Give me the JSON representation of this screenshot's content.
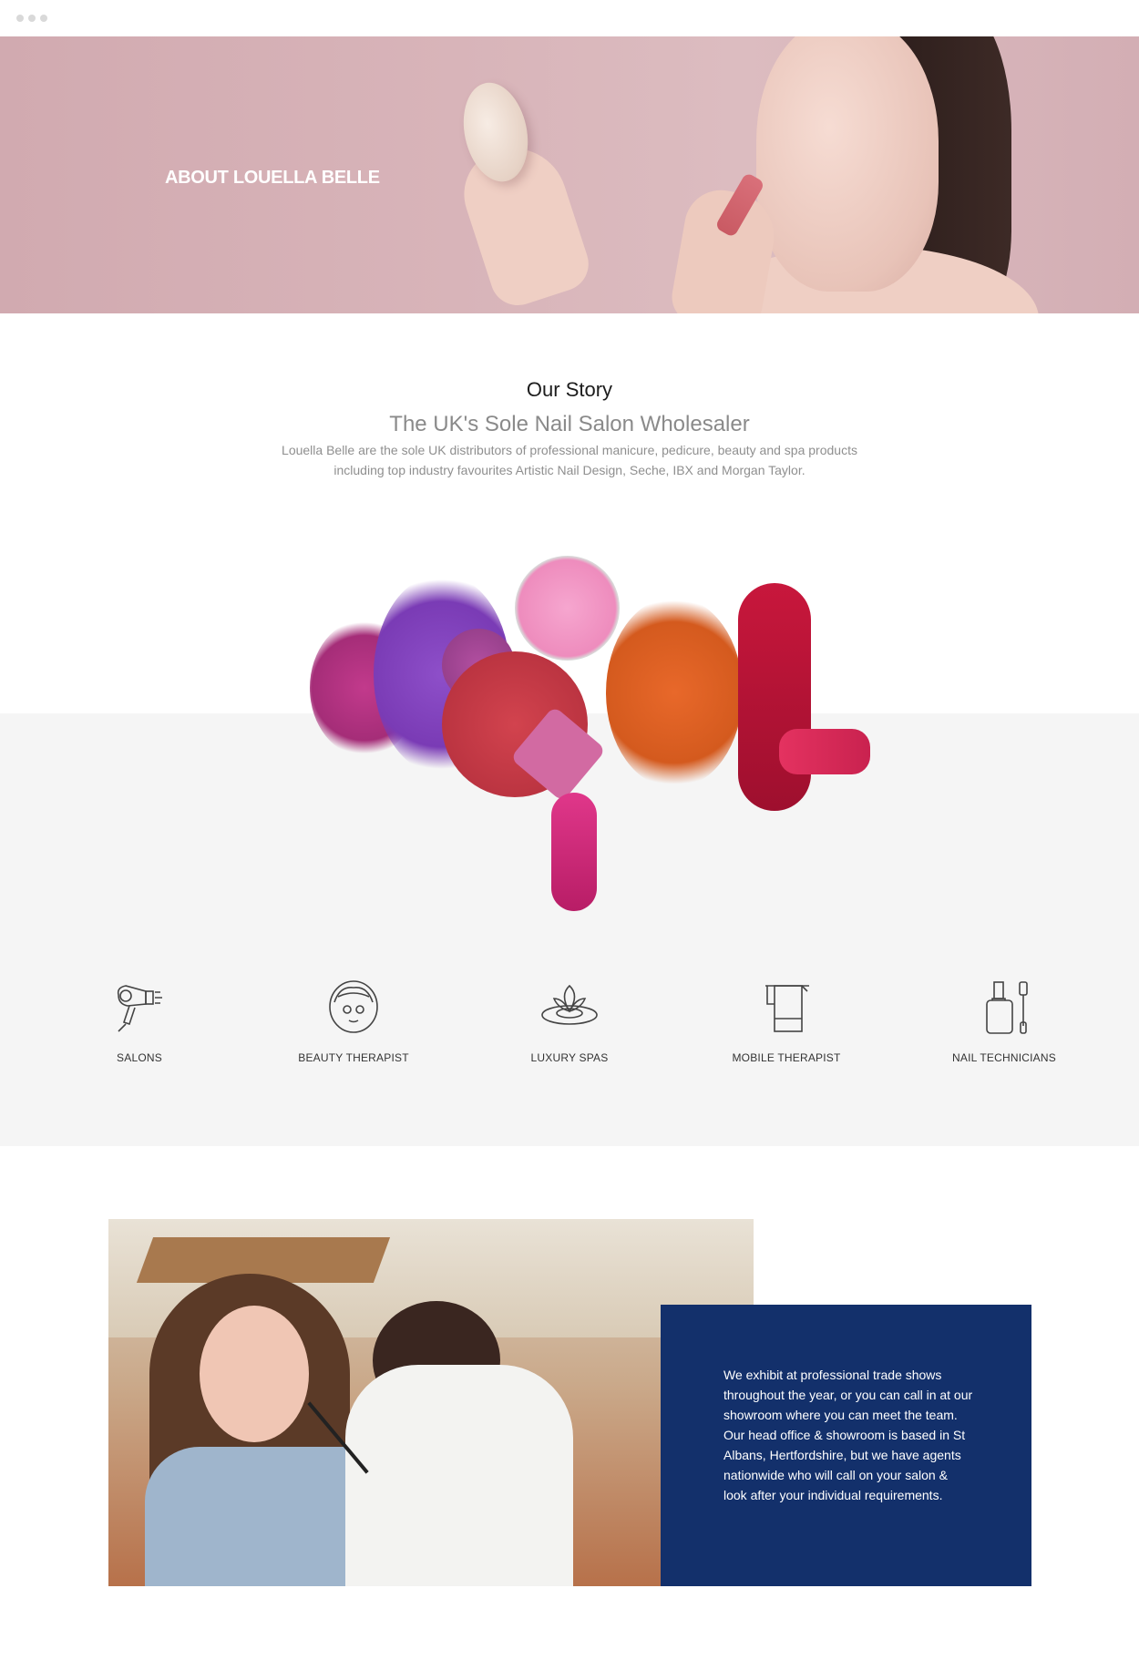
{
  "hero": {
    "title": "ABOUT LOUELLA BELLE"
  },
  "story": {
    "heading": "Our Story",
    "subheading": "The UK's Sole Nail Salon Wholesaler",
    "text": "Louella Belle are the sole UK distributors of professional manicure, pedicure, beauty and spa products including top industry favourites Artistic Nail Design, Seche, IBX and Morgan Taylor."
  },
  "services": [
    {
      "label": "SALONS",
      "icon": "hair-dryer-icon"
    },
    {
      "label": "BEAUTY THERAPIST",
      "icon": "face-mask-icon"
    },
    {
      "label": "LUXURY SPAS",
      "icon": "lotus-icon"
    },
    {
      "label": "MOBILE THERAPIST",
      "icon": "towel-icon"
    },
    {
      "label": "NAIL TECHNICIANS",
      "icon": "nail-polish-icon"
    }
  ],
  "info": {
    "text": "We exhibit at professional trade shows throughout the year, or you can call in at our showroom where you can meet the team. Our head office & showroom is based in St Albans, Hertfordshire, but we have agents nationwide who will call on your salon & look after your individual requirements."
  },
  "colors": {
    "hero_bg": "#d8b4b9",
    "info_bg": "#13306b",
    "band_bg": "#f5f5f5"
  }
}
